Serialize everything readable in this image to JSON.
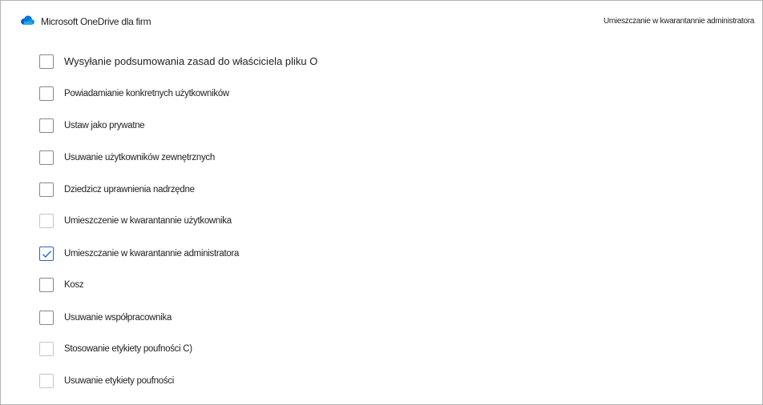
{
  "header": {
    "app_title": "Microsoft OneDrive dla firm",
    "page_title": "Umieszczanie w kwarantannie administratora",
    "logo_icon": "onedrive-cloud-icon",
    "brand_color": "#0364b8"
  },
  "options": [
    {
      "label": "Wysyłanie podsumowania zasad do właściciela pliku O",
      "checked": false,
      "disabled": false
    },
    {
      "label": "Powiadamianie konkretnych użytkowników",
      "checked": false,
      "disabled": false
    },
    {
      "label": "Ustaw jako prywatne",
      "checked": false,
      "disabled": false
    },
    {
      "label": "Usuwanie użytkowników zewnętrznych",
      "checked": false,
      "disabled": false
    },
    {
      "label": "Dziedzicz uprawnienia nadrzędne",
      "checked": false,
      "disabled": false
    },
    {
      "label": "Umieszczenie w kwarantannie użytkownika",
      "checked": false,
      "disabled": true
    },
    {
      "label": "Umieszczanie w kwarantannie administratora",
      "checked": true,
      "disabled": false
    },
    {
      "label": "Kosz",
      "checked": false,
      "disabled": false
    },
    {
      "label": "Usuwanie współpracownika",
      "checked": false,
      "disabled": false
    },
    {
      "label": "Stosowanie etykiety poufności C)",
      "checked": false,
      "disabled": true
    },
    {
      "label": "Usuwanie etykiety poufności",
      "checked": false,
      "disabled": true
    }
  ]
}
